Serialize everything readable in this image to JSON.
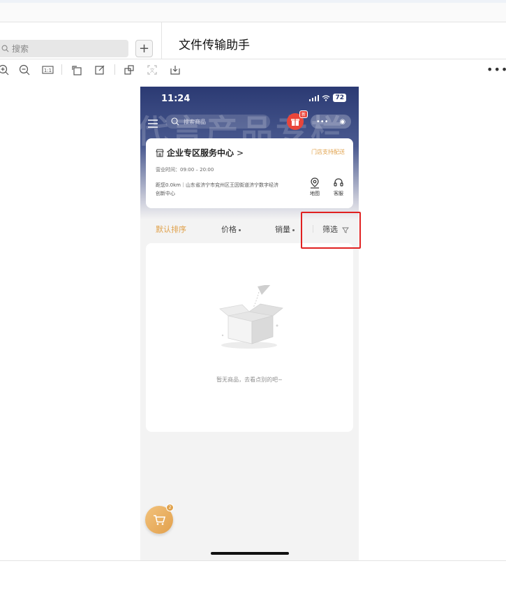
{
  "app": {
    "search_placeholder": "搜索",
    "add_label": "+",
    "chat_title": "文件传输助手",
    "more_label": "•••",
    "toolbar_icons": [
      "zoom-in-icon",
      "zoom-out-icon",
      "actual-size-icon",
      "rotate-icon",
      "edit-icon",
      "copy-icon",
      "scan-icon",
      "download-icon"
    ]
  },
  "phone": {
    "status_time": "11:24",
    "battery": "72",
    "hero_bg_text": "代言产品专栏",
    "search_placeholder": "搜索商品",
    "new_tag": "新",
    "store": {
      "title": "企业专区服务中心",
      "chevron": ">",
      "tag": "门店支持配送",
      "hours": "营业时间：09:00 – 20:00",
      "address": "距您0.0km｜山东省济宁市兖州区王因街道济宁数字经济创新中心",
      "map_label": "地图",
      "service_label": "客服"
    },
    "sort": {
      "default": "默认排序",
      "price": "价格",
      "sales": "销量",
      "filter": "筛选"
    },
    "empty_text": "暂无商品，去看点别的吧~",
    "cart_count": "2"
  },
  "colors": {
    "accent": "#e0a24c",
    "highlight": "#e02020",
    "hero_top": "#2b3a73"
  }
}
